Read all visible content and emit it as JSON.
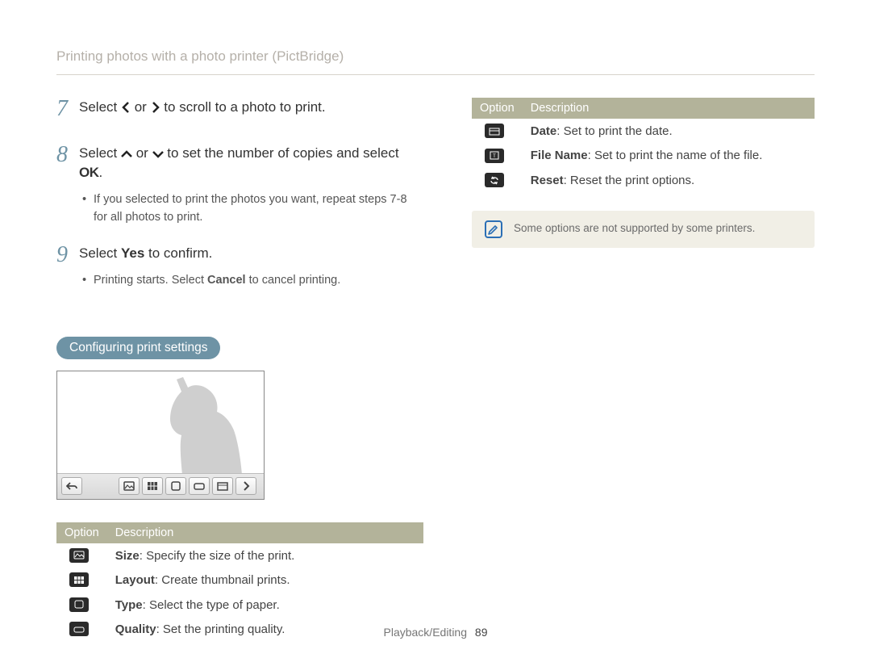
{
  "breadcrumb": "Printing photos with a photo printer (PictBridge)",
  "steps": {
    "s7": {
      "num": "7",
      "pre": "Select ",
      "mid": " or ",
      "post": " to scroll to a photo to print."
    },
    "s8": {
      "num": "8",
      "pre": "Select ",
      "mid": " or ",
      "post": " to set the number of copies and select ",
      "ok": "OK",
      "dot": ".",
      "bullet": "If you selected to print the photos you want, repeat steps 7-8 for all photos to print."
    },
    "s9": {
      "num": "9",
      "pre": "Select ",
      "yes": "Yes",
      "post": " to confirm.",
      "bullet_a": "Printing starts. Select ",
      "bullet_bold": "Cancel",
      "bullet_b": " to cancel printing."
    }
  },
  "pill": "Configuring print settings",
  "table_head": {
    "option": "Option",
    "desc": "Description"
  },
  "left_rows": {
    "size": {
      "bold": "Size",
      "rest": ": Specify the size of the print."
    },
    "layout": {
      "bold": "Layout",
      "rest": ": Create thumbnail prints."
    },
    "type": {
      "bold": "Type",
      "rest": ": Select the type of paper."
    },
    "quality": {
      "bold": "Quality",
      "rest": ": Set the printing quality."
    }
  },
  "right_rows": {
    "date": {
      "bold": "Date",
      "rest": ": Set to print the date."
    },
    "file": {
      "bold": "File Name",
      "rest": ": Set to print the name of the file."
    },
    "reset": {
      "bold": "Reset",
      "rest": ": Reset the print options."
    }
  },
  "note": "Some options are not supported by some printers.",
  "footer_section": "Playback/Editing",
  "footer_page": "89"
}
